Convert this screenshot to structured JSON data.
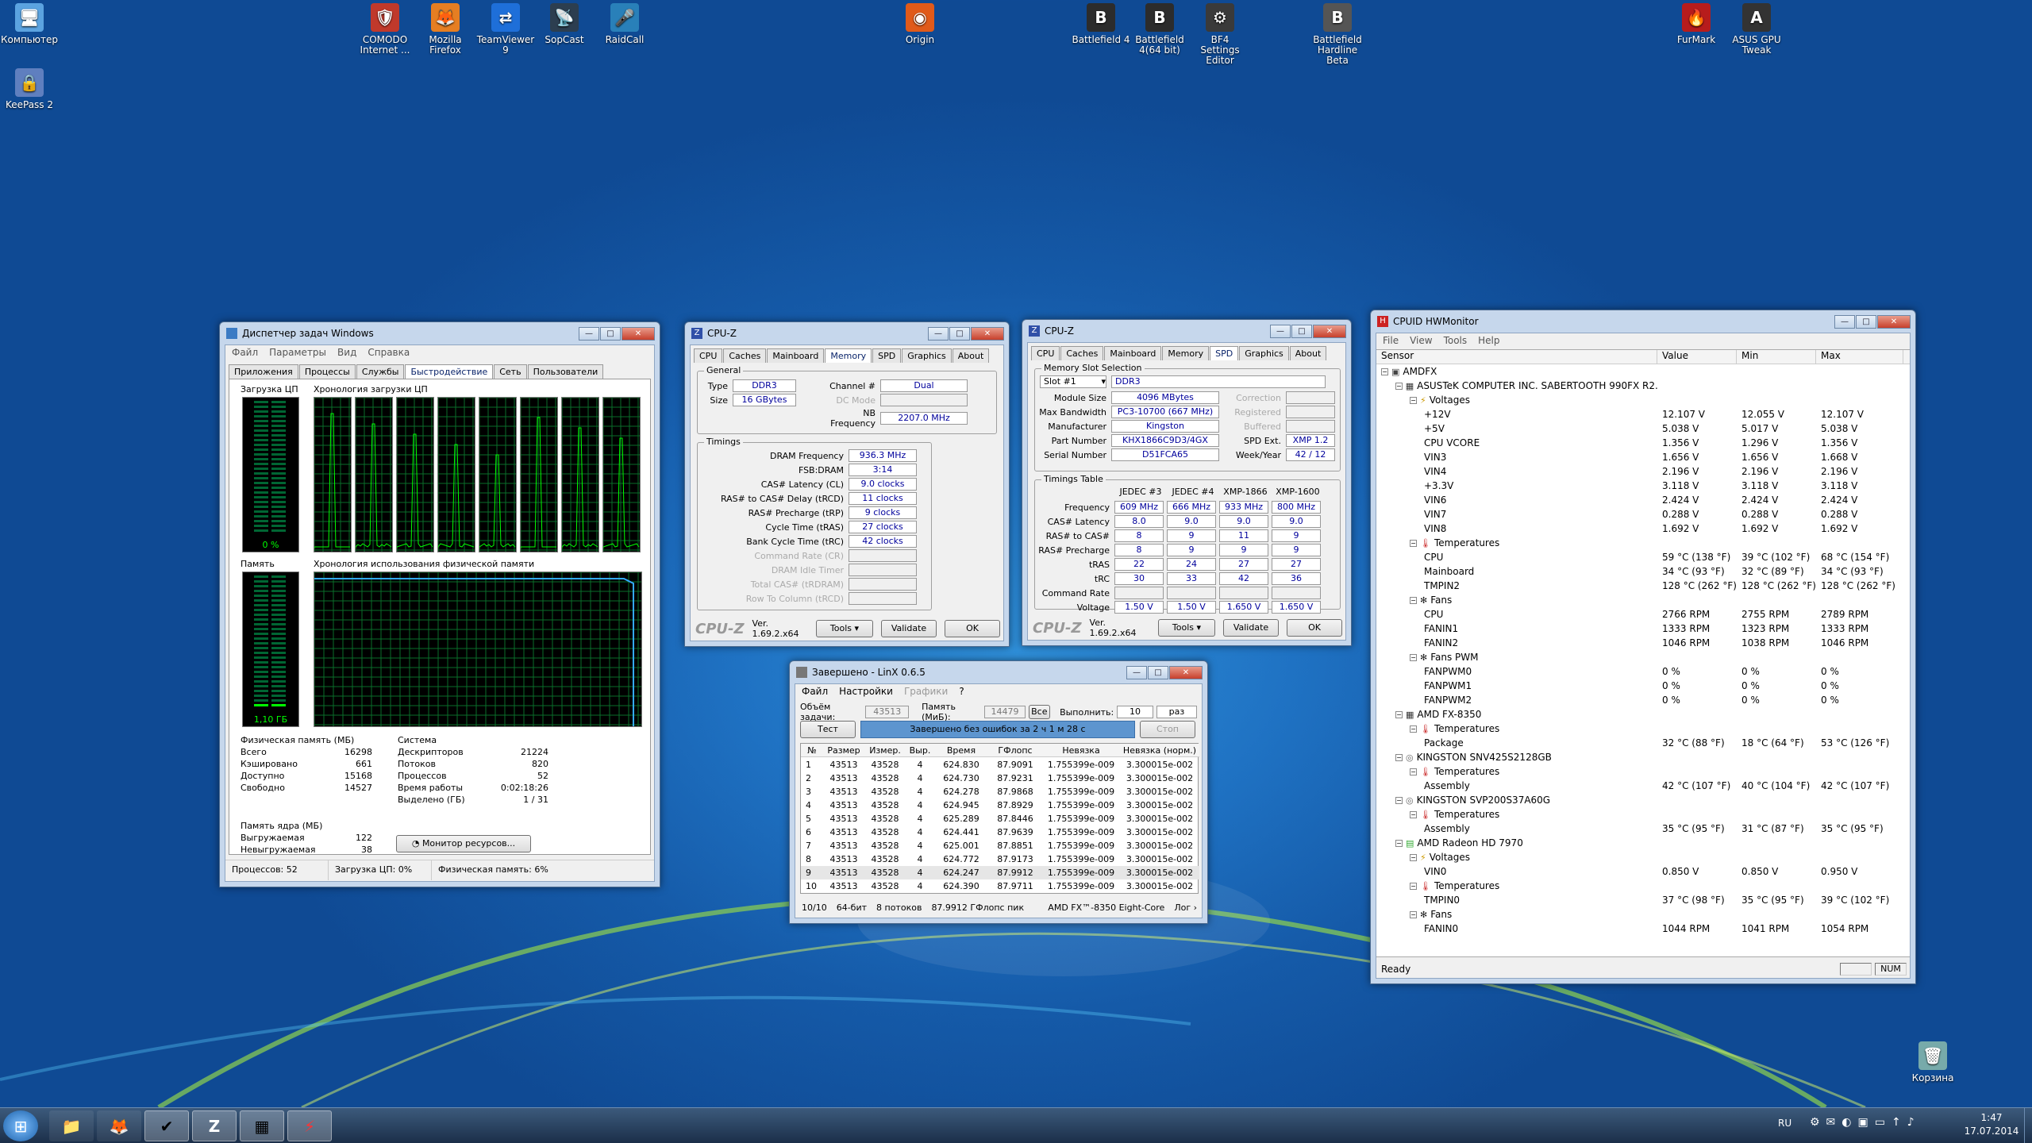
{
  "desktop": {
    "icons": [
      {
        "label": "Компьютер",
        "glyph": "🖥"
      },
      {
        "label": "KeePass 2",
        "glyph": "🔒"
      },
      {
        "label": "COMODO Internet ...",
        "glyph": "🛡"
      },
      {
        "label": "Mozilla Firefox",
        "glyph": "🦊"
      },
      {
        "label": "TeamViewer 9",
        "glyph": "⇄"
      },
      {
        "label": "SopCast",
        "glyph": "📡"
      },
      {
        "label": "RaidCall",
        "glyph": "🎤"
      },
      {
        "label": "Origin",
        "glyph": "◉"
      },
      {
        "label": "Battlefield 4",
        "glyph": "B"
      },
      {
        "label": "Battlefield 4(64 bit)",
        "glyph": "B"
      },
      {
        "label": "BF4 Settings Editor",
        "glyph": "⚙"
      },
      {
        "label": "Battlefield Hardline Beta",
        "glyph": "B"
      },
      {
        "label": "FurMark",
        "glyph": "🔥"
      },
      {
        "label": "ASUS GPU Tweak",
        "glyph": "A"
      },
      {
        "label": "Корзина",
        "glyph": "🗑"
      }
    ]
  },
  "taskmgr": {
    "title": "Диспетчер задач Windows",
    "menu": [
      "Файл",
      "Параметры",
      "Вид",
      "Справка"
    ],
    "tabs": [
      "Приложения",
      "Процессы",
      "Службы",
      "Быстродействие",
      "Сеть",
      "Пользователи"
    ],
    "cpu_label": "Загрузка ЦП",
    "cpu_history_label": "Хронология загрузки ЦП",
    "cpu_value": "0 %",
    "mem_label": "Память",
    "mem_history_label": "Хронология использования физической памяти",
    "mem_value": "1,10 ГБ",
    "phys_title": "Физическая память (МБ)",
    "phys": [
      [
        "Всего",
        "16298"
      ],
      [
        "Кэшировано",
        "661"
      ],
      [
        "Доступно",
        "15168"
      ],
      [
        "Свободно",
        "14527"
      ]
    ],
    "sys_title": "Система",
    "sys": [
      [
        "Дескрипторов",
        "21224"
      ],
      [
        "Потоков",
        "820"
      ],
      [
        "Процессов",
        "52"
      ],
      [
        "Время работы",
        "0:02:18:26"
      ],
      [
        "Выделено (ГБ)",
        "1 / 31"
      ]
    ],
    "kernel_title": "Память ядра (МБ)",
    "kernel": [
      [
        "Выгружаемая",
        "122"
      ],
      [
        "Невыгружаемая",
        "38"
      ]
    ],
    "monitor_btn": "Монитор ресурсов...",
    "status": [
      "Процессов: 52",
      "Загрузка ЦП: 0%",
      "Физическая память: 6%"
    ]
  },
  "cpuz1": {
    "title": "CPU-Z",
    "tabs": [
      "CPU",
      "Caches",
      "Mainboard",
      "Memory",
      "SPD",
      "Graphics",
      "About"
    ],
    "general_legend": "General",
    "type_label": "Type",
    "type": "DDR3",
    "size_label": "Size",
    "size": "16 GBytes",
    "channel_label": "Channel #",
    "channel": "Dual",
    "dcmode_label": "DC Mode",
    "nb_label": "NB Frequency",
    "nb": "2207.0 MHz",
    "timings_legend": "Timings",
    "timings": [
      [
        "DRAM Frequency",
        "936.3 MHz"
      ],
      [
        "FSB:DRAM",
        "3:14"
      ],
      [
        "CAS# Latency (CL)",
        "9.0 clocks"
      ],
      [
        "RAS# to CAS# Delay (tRCD)",
        "11 clocks"
      ],
      [
        "RAS# Precharge (tRP)",
        "9 clocks"
      ],
      [
        "Cycle Time (tRAS)",
        "27 clocks"
      ],
      [
        "Bank Cycle Time (tRC)",
        "42 clocks"
      ],
      [
        "Command Rate (CR)",
        ""
      ],
      [
        "DRAM Idle Timer",
        ""
      ],
      [
        "Total CAS# (tRDRAM)",
        ""
      ],
      [
        "Row To Column (tRCD)",
        ""
      ]
    ],
    "brand": "CPU-Z",
    "version": "Ver. 1.69.2.x64",
    "tools": "Tools",
    "validate": "Validate",
    "ok": "OK"
  },
  "cpuz2": {
    "title": "CPU-Z",
    "tabs": [
      "CPU",
      "Caches",
      "Mainboard",
      "Memory",
      "SPD",
      "Graphics",
      "About"
    ],
    "slot_legend": "Memory Slot Selection",
    "slot": "Slot #1",
    "slot_type": "DDR3",
    "left": [
      [
        "Module Size",
        "4096 MBytes"
      ],
      [
        "Max Bandwidth",
        "PC3-10700 (667 MHz)"
      ],
      [
        "Manufacturer",
        "Kingston"
      ],
      [
        "Part Number",
        "KHX1866C9D3/4GX"
      ],
      [
        "Serial Number",
        "D51FCA65"
      ]
    ],
    "right": [
      [
        "Correction",
        ""
      ],
      [
        "Registered",
        ""
      ],
      [
        "Buffered",
        ""
      ],
      [
        "SPD Ext.",
        "XMP 1.2"
      ],
      [
        "Week/Year",
        "42 / 12"
      ]
    ],
    "timings_legend": "Timings Table",
    "cols": [
      "JEDEC #3",
      "JEDEC #4",
      "XMP-1866",
      "XMP-1600"
    ],
    "rows": [
      {
        "label": "Frequency",
        "v": [
          "609 MHz",
          "666 MHz",
          "933 MHz",
          "800 MHz"
        ]
      },
      {
        "label": "CAS# Latency",
        "v": [
          "8.0",
          "9.0",
          "9.0",
          "9.0"
        ]
      },
      {
        "label": "RAS# to CAS#",
        "v": [
          "8",
          "9",
          "11",
          "9"
        ]
      },
      {
        "label": "RAS# Precharge",
        "v": [
          "8",
          "9",
          "9",
          "9"
        ]
      },
      {
        "label": "tRAS",
        "v": [
          "22",
          "24",
          "27",
          "27"
        ]
      },
      {
        "label": "tRC",
        "v": [
          "30",
          "33",
          "42",
          "36"
        ]
      },
      {
        "label": "Command Rate",
        "v": [
          "",
          "",
          "",
          ""
        ]
      },
      {
        "label": "Voltage",
        "v": [
          "1.50 V",
          "1.50 V",
          "1.650 V",
          "1.650 V"
        ]
      }
    ],
    "brand": "CPU-Z",
    "version": "Ver. 1.69.2.x64",
    "tools": "Tools",
    "validate": "Validate",
    "ok": "OK"
  },
  "linx": {
    "title": "Завершено - LinX 0.6.5",
    "menu": [
      "Файл",
      "Настройки",
      "Графики",
      "?"
    ],
    "size_label": "Объём задачи:",
    "size": "43513",
    "mem_label": "Память (МиБ):",
    "mem": "14479",
    "all": "Все",
    "run_label": "Выполнить:",
    "runs": "10",
    "unit": "раз",
    "test_btn": "Тест",
    "progress": "Завершено без ошибок за 2 ч 1 м 28 с",
    "stop_btn": "Стоп",
    "headers": [
      "№",
      "Размер",
      "Измер.",
      "Выр.",
      "Время",
      "ГФлопс",
      "Невязка",
      "Невязка (норм.)"
    ],
    "rows": [
      [
        "1",
        "43513",
        "43528",
        "4",
        "624.830",
        "87.9091",
        "1.755399e-009",
        "3.300015e-002"
      ],
      [
        "2",
        "43513",
        "43528",
        "4",
        "624.730",
        "87.9231",
        "1.755399e-009",
        "3.300015e-002"
      ],
      [
        "3",
        "43513",
        "43528",
        "4",
        "624.278",
        "87.9868",
        "1.755399e-009",
        "3.300015e-002"
      ],
      [
        "4",
        "43513",
        "43528",
        "4",
        "624.945",
        "87.8929",
        "1.755399e-009",
        "3.300015e-002"
      ],
      [
        "5",
        "43513",
        "43528",
        "4",
        "625.289",
        "87.8446",
        "1.755399e-009",
        "3.300015e-002"
      ],
      [
        "6",
        "43513",
        "43528",
        "4",
        "624.441",
        "87.9639",
        "1.755399e-009",
        "3.300015e-002"
      ],
      [
        "7",
        "43513",
        "43528",
        "4",
        "625.001",
        "87.8851",
        "1.755399e-009",
        "3.300015e-002"
      ],
      [
        "8",
        "43513",
        "43528",
        "4",
        "624.772",
        "87.9173",
        "1.755399e-009",
        "3.300015e-002"
      ],
      [
        "9",
        "43513",
        "43528",
        "4",
        "624.247",
        "87.9912",
        "1.755399e-009",
        "3.300015e-002"
      ],
      [
        "10",
        "43513",
        "43528",
        "4",
        "624.390",
        "87.9711",
        "1.755399e-009",
        "3.300015e-002"
      ]
    ],
    "status": [
      "10/10",
      "64-бит",
      "8 потоков",
      "87.9912 ГФлопс пик",
      "AMD FX™-8350 Eight-Core",
      "Лог ›"
    ]
  },
  "hwmon": {
    "title": "CPUID HWMonitor",
    "menu": [
      "File",
      "View",
      "Tools",
      "Help"
    ],
    "headers": [
      "Sensor",
      "Value",
      "Min",
      "Max"
    ],
    "status": "Ready",
    "num": "NUM",
    "rows": [
      {
        "lvl": 0,
        "icon": "pc",
        "label": "AMDFX",
        "v": [
          "",
          "",
          ""
        ]
      },
      {
        "lvl": 1,
        "icon": "chip",
        "label": "ASUSTeK COMPUTER INC. SABERTOOTH 990FX R2.0",
        "v": [
          "",
          "",
          ""
        ]
      },
      {
        "lvl": 2,
        "icon": "volt",
        "label": "Voltages",
        "v": [
          "",
          "",
          ""
        ]
      },
      {
        "lvl": 3,
        "label": "+12V",
        "v": [
          "12.107 V",
          "12.055 V",
          "12.107 V"
        ]
      },
      {
        "lvl": 3,
        "label": "+5V",
        "v": [
          "5.038 V",
          "5.017 V",
          "5.038 V"
        ]
      },
      {
        "lvl": 3,
        "label": "CPU VCORE",
        "v": [
          "1.356 V",
          "1.296 V",
          "1.356 V"
        ]
      },
      {
        "lvl": 3,
        "label": "VIN3",
        "v": [
          "1.656 V",
          "1.656 V",
          "1.668 V"
        ]
      },
      {
        "lvl": 3,
        "label": "VIN4",
        "v": [
          "2.196 V",
          "2.196 V",
          "2.196 V"
        ]
      },
      {
        "lvl": 3,
        "label": "+3.3V",
        "v": [
          "3.118 V",
          "3.118 V",
          "3.118 V"
        ]
      },
      {
        "lvl": 3,
        "label": "VIN6",
        "v": [
          "2.424 V",
          "2.424 V",
          "2.424 V"
        ]
      },
      {
        "lvl": 3,
        "label": "VIN7",
        "v": [
          "0.288 V",
          "0.288 V",
          "0.288 V"
        ]
      },
      {
        "lvl": 3,
        "label": "VIN8",
        "v": [
          "1.692 V",
          "1.692 V",
          "1.692 V"
        ]
      },
      {
        "lvl": 2,
        "icon": "temp",
        "label": "Temperatures",
        "v": [
          "",
          "",
          ""
        ]
      },
      {
        "lvl": 3,
        "label": "CPU",
        "v": [
          "59 °C (138 °F)",
          "39 °C (102 °F)",
          "68 °C (154 °F)"
        ]
      },
      {
        "lvl": 3,
        "label": "Mainboard",
        "v": [
          "34 °C (93 °F)",
          "32 °C (89 °F)",
          "34 °C (93 °F)"
        ]
      },
      {
        "lvl": 3,
        "label": "TMPIN2",
        "v": [
          "128 °C (262 °F)",
          "128 °C (262 °F)",
          "128 °C (262 °F)"
        ]
      },
      {
        "lvl": 2,
        "icon": "fan",
        "label": "Fans",
        "v": [
          "",
          "",
          ""
        ]
      },
      {
        "lvl": 3,
        "label": "CPU",
        "v": [
          "2766 RPM",
          "2755 RPM",
          "2789 RPM"
        ]
      },
      {
        "lvl": 3,
        "label": "FANIN1",
        "v": [
          "1333 RPM",
          "1323 RPM",
          "1333 RPM"
        ]
      },
      {
        "lvl": 3,
        "label": "FANIN2",
        "v": [
          "1046 RPM",
          "1038 RPM",
          "1046 RPM"
        ]
      },
      {
        "lvl": 2,
        "icon": "fan",
        "label": "Fans PWM",
        "v": [
          "",
          "",
          ""
        ]
      },
      {
        "lvl": 3,
        "label": "FANPWM0",
        "v": [
          "0 %",
          "0 %",
          "0 %"
        ]
      },
      {
        "lvl": 3,
        "label": "FANPWM1",
        "v": [
          "0 %",
          "0 %",
          "0 %"
        ]
      },
      {
        "lvl": 3,
        "label": "FANPWM2",
        "v": [
          "0 %",
          "0 %",
          "0 %"
        ]
      },
      {
        "lvl": 1,
        "icon": "chip",
        "label": "AMD FX-8350",
        "v": [
          "",
          "",
          ""
        ]
      },
      {
        "lvl": 2,
        "icon": "temp",
        "label": "Temperatures",
        "v": [
          "",
          "",
          ""
        ]
      },
      {
        "lvl": 3,
        "label": "Package",
        "v": [
          "32 °C (88 °F)",
          "18 °C (64 °F)",
          "53 °C (126 °F)"
        ]
      },
      {
        "lvl": 1,
        "icon": "disk",
        "label": "KINGSTON SNV425S2128GB",
        "v": [
          "",
          "",
          ""
        ]
      },
      {
        "lvl": 2,
        "icon": "temp",
        "label": "Temperatures",
        "v": [
          "",
          "",
          ""
        ]
      },
      {
        "lvl": 3,
        "label": "Assembly",
        "v": [
          "42 °C (107 °F)",
          "40 °C (104 °F)",
          "42 °C (107 °F)"
        ]
      },
      {
        "lvl": 1,
        "icon": "disk",
        "label": "KINGSTON SVP200S37A60G",
        "v": [
          "",
          "",
          ""
        ]
      },
      {
        "lvl": 2,
        "icon": "temp",
        "label": "Temperatures",
        "v": [
          "",
          "",
          ""
        ]
      },
      {
        "lvl": 3,
        "label": "Assembly",
        "v": [
          "35 °C (95 °F)",
          "31 °C (87 °F)",
          "35 °C (95 °F)"
        ]
      },
      {
        "lvl": 1,
        "icon": "gpu",
        "label": "AMD Radeon HD 7970",
        "v": [
          "",
          "",
          ""
        ]
      },
      {
        "lvl": 2,
        "icon": "volt",
        "label": "Voltages",
        "v": [
          "",
          "",
          ""
        ]
      },
      {
        "lvl": 3,
        "label": "VIN0",
        "v": [
          "0.850 V",
          "0.850 V",
          "0.950 V"
        ]
      },
      {
        "lvl": 2,
        "icon": "temp",
        "label": "Temperatures",
        "v": [
          "",
          "",
          ""
        ]
      },
      {
        "lvl": 3,
        "label": "TMPIN0",
        "v": [
          "37 °C (98 °F)",
          "35 °C (95 °F)",
          "39 °C (102 °F)"
        ]
      },
      {
        "lvl": 2,
        "icon": "fan",
        "label": "Fans",
        "v": [
          "",
          "",
          ""
        ]
      },
      {
        "lvl": 3,
        "label": "FANIN0",
        "v": [
          "1044 RPM",
          "1041 RPM",
          "1054 RPM"
        ]
      }
    ]
  },
  "taskbar": {
    "lang": "RU",
    "time": "1:47",
    "date": "17.07.2014",
    "apps": [
      "start",
      "explorer",
      "firefox",
      "notes",
      "cpuz",
      "taskmgr",
      "furmark"
    ]
  }
}
